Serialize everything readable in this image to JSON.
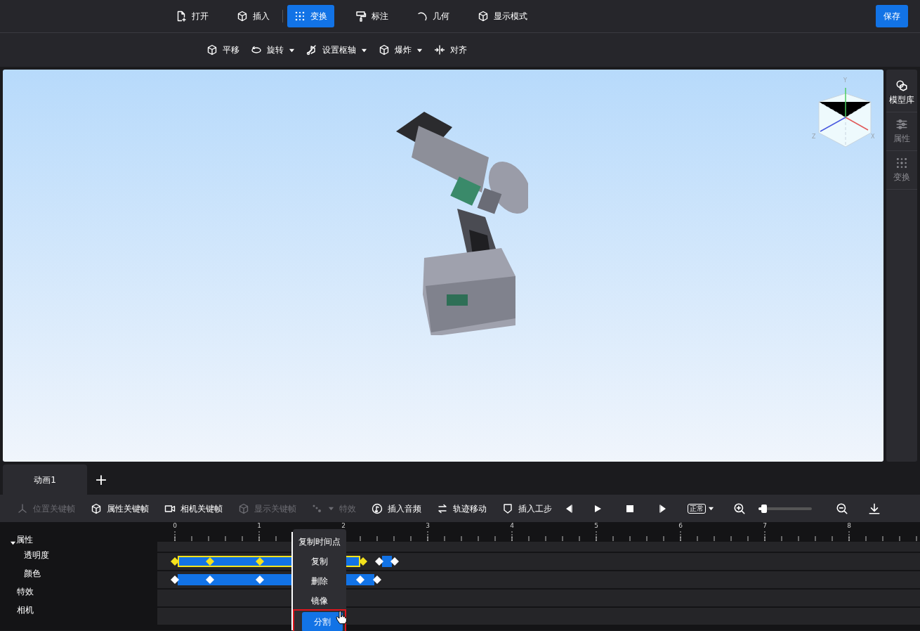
{
  "main_toolbar": [
    {
      "label": "打开",
      "selected": false
    },
    {
      "label": "插入",
      "selected": false
    },
    {
      "label": "变换",
      "selected": true
    },
    {
      "label": "标注",
      "selected": false
    },
    {
      "label": "几何",
      "selected": false
    },
    {
      "label": "显示模式",
      "selected": false
    }
  ],
  "save_button": "保存",
  "sub_toolbar": [
    {
      "label": "平移",
      "dropdown": false
    },
    {
      "label": "旋转",
      "dropdown": true
    },
    {
      "label": "设置枢轴",
      "dropdown": true
    },
    {
      "label": "爆炸",
      "dropdown": true
    },
    {
      "label": "对齐",
      "dropdown": false
    }
  ],
  "view_cube": {
    "axes": [
      "Y",
      "Z",
      "X"
    ]
  },
  "side_panel": [
    {
      "label": "模型库",
      "selected": true
    },
    {
      "label": "属性",
      "selected": false
    },
    {
      "label": "变换",
      "selected": false
    }
  ],
  "animation_tabs": [
    {
      "label": "动画1",
      "selected": true
    }
  ],
  "add_tab": "+",
  "timeline_toolbar": [
    {
      "label": "位置关键帧",
      "disabled": true,
      "dropdown": false
    },
    {
      "label": "属性关键帧",
      "disabled": false,
      "dropdown": false
    },
    {
      "label": "相机关键帧",
      "disabled": false,
      "dropdown": false
    },
    {
      "label": "显示关键帧",
      "disabled": true,
      "dropdown": false
    },
    {
      "label": "特效",
      "disabled": true,
      "dropdown": true
    },
    {
      "label": "插入音频",
      "disabled": false,
      "dropdown": false
    },
    {
      "label": "轨迹移动",
      "disabled": false,
      "dropdown": false
    },
    {
      "label": "插入工步",
      "disabled": false,
      "dropdown": false
    }
  ],
  "playback": {
    "speed_label": "正常",
    "level": 0.1
  },
  "ruler": {
    "labels": [
      "0",
      "1",
      "2",
      "3",
      "4",
      "5",
      "6",
      "7",
      "8"
    ]
  },
  "tracks": [
    {
      "label": "属性",
      "expanded": true,
      "children": [
        {
          "label": "透明度",
          "clips": [
            {
              "selected": true,
              "keyframes": [
                {
                  "level": 0.023
                },
                {
                  "level": 0.069
                },
                {
                  "level": 0.134
                },
                {
                  "level": 0.27
                }
              ]
            },
            {
              "selected": false,
              "keyframes": [
                {
                  "level": 0.291
                },
                {
                  "level": 0.311
                }
              ]
            }
          ]
        },
        {
          "label": "颜色",
          "clips": [
            {
              "selected": false,
              "keyframes": [
                {
                  "level": 0.023
                },
                {
                  "level": 0.069
                },
                {
                  "level": 0.134
                },
                {
                  "level": 0.266
                },
                {
                  "level": 0.288
                }
              ]
            }
          ]
        }
      ]
    },
    {
      "label": "特效"
    },
    {
      "label": "相机"
    }
  ],
  "context_menu": [
    {
      "label": "复制时间点",
      "selected": false
    },
    {
      "label": "复制",
      "selected": false
    },
    {
      "label": "删除",
      "selected": false
    },
    {
      "label": "镜像",
      "selected": false
    },
    {
      "label": "分割",
      "selected": true
    }
  ]
}
